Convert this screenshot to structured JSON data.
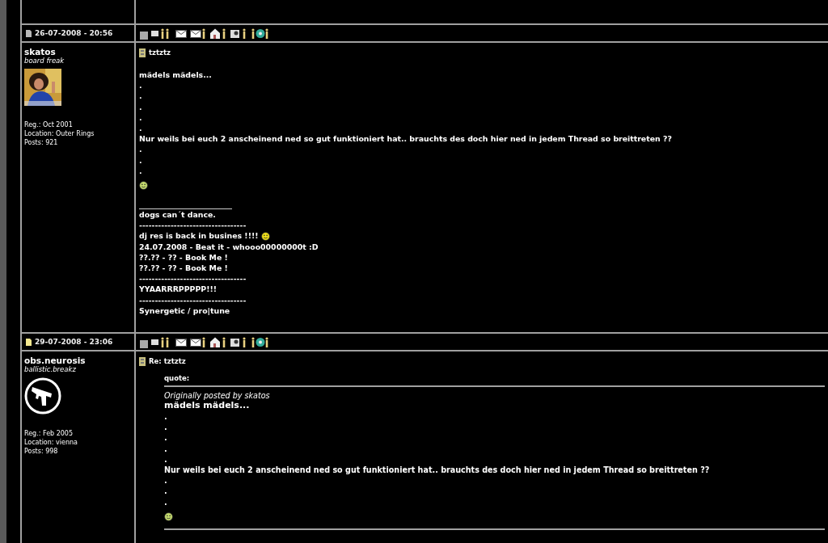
{
  "posts": [
    {
      "date": "26-07-2008 - 20:56",
      "unread": false,
      "author": {
        "name": "skatos",
        "title": "board freak",
        "info": [
          "Reg.: Oct 2001",
          "Location: Outer Rings",
          "Posts: 921"
        ]
      },
      "subject": "tztztz",
      "body": [
        {
          "kind": "gap"
        },
        {
          "kind": "text",
          "text": "mädels mädels..."
        },
        {
          "kind": "text",
          "text": "."
        },
        {
          "kind": "text",
          "text": "."
        },
        {
          "kind": "text",
          "text": "."
        },
        {
          "kind": "text",
          "text": "."
        },
        {
          "kind": "text",
          "text": "."
        },
        {
          "kind": "text",
          "text": "Nur weils bei euch 2 anscheinend ned so gut funktioniert hat.. brauchts des doch hier ned in jedem Thread so breittreten ??"
        },
        {
          "kind": "text",
          "text": "."
        },
        {
          "kind": "text",
          "text": "."
        },
        {
          "kind": "text",
          "text": "."
        },
        {
          "kind": "smiley"
        },
        {
          "kind": "gap"
        },
        {
          "kind": "rule"
        },
        {
          "kind": "text",
          "text": "dogs can´t dance."
        },
        {
          "kind": "text",
          "text": "----------------------------------"
        },
        {
          "kind": "text_smiley",
          "text": "dj res is back in busines !!!!"
        },
        {
          "kind": "text",
          "text": "24.07.2008 - Beat it - whooo00000000t :D"
        },
        {
          "kind": "text",
          "text": "??.?? - ?? - Book Me !"
        },
        {
          "kind": "text",
          "text": "??.?? - ?? - Book Me !"
        },
        {
          "kind": "text",
          "text": "----------------------------------"
        },
        {
          "kind": "text",
          "text": "YYAARRRPPPPP!!!"
        },
        {
          "kind": "text",
          "text": "----------------------------------"
        },
        {
          "kind": "text",
          "text": "Synergetic / pro|tune"
        }
      ]
    },
    {
      "date": "29-07-2008 - 23:06",
      "unread": true,
      "author": {
        "name": "obs.neurosis",
        "title": "ballistic.breakz",
        "avatar": {
          "kind": "logo"
        },
        "info": [
          "Reg.: Feb 2005",
          "Location: vienna",
          "Posts: 998"
        ]
      },
      "subject": "Re: tztztz",
      "body": [
        {
          "kind": "quote",
          "label": "quote:",
          "byline": "Originally posted by skatos",
          "lines": [
            {
              "kind": "title",
              "text": "mädels mädels..."
            },
            {
              "kind": "text",
              "text": "."
            },
            {
              "kind": "text",
              "text": "."
            },
            {
              "kind": "text",
              "text": "."
            },
            {
              "kind": "text",
              "text": "."
            },
            {
              "kind": "text",
              "text": "."
            },
            {
              "kind": "text",
              "text": "Nur weils bei euch 2 anscheinend ned so gut funktioniert hat.. brauchts des doch hier ned in jedem Thread so breittreten ??"
            },
            {
              "kind": "text",
              "text": "."
            },
            {
              "kind": "text",
              "text": "."
            },
            {
              "kind": "text",
              "text": "."
            },
            {
              "kind": "smiley"
            }
          ]
        }
      ]
    }
  ]
}
